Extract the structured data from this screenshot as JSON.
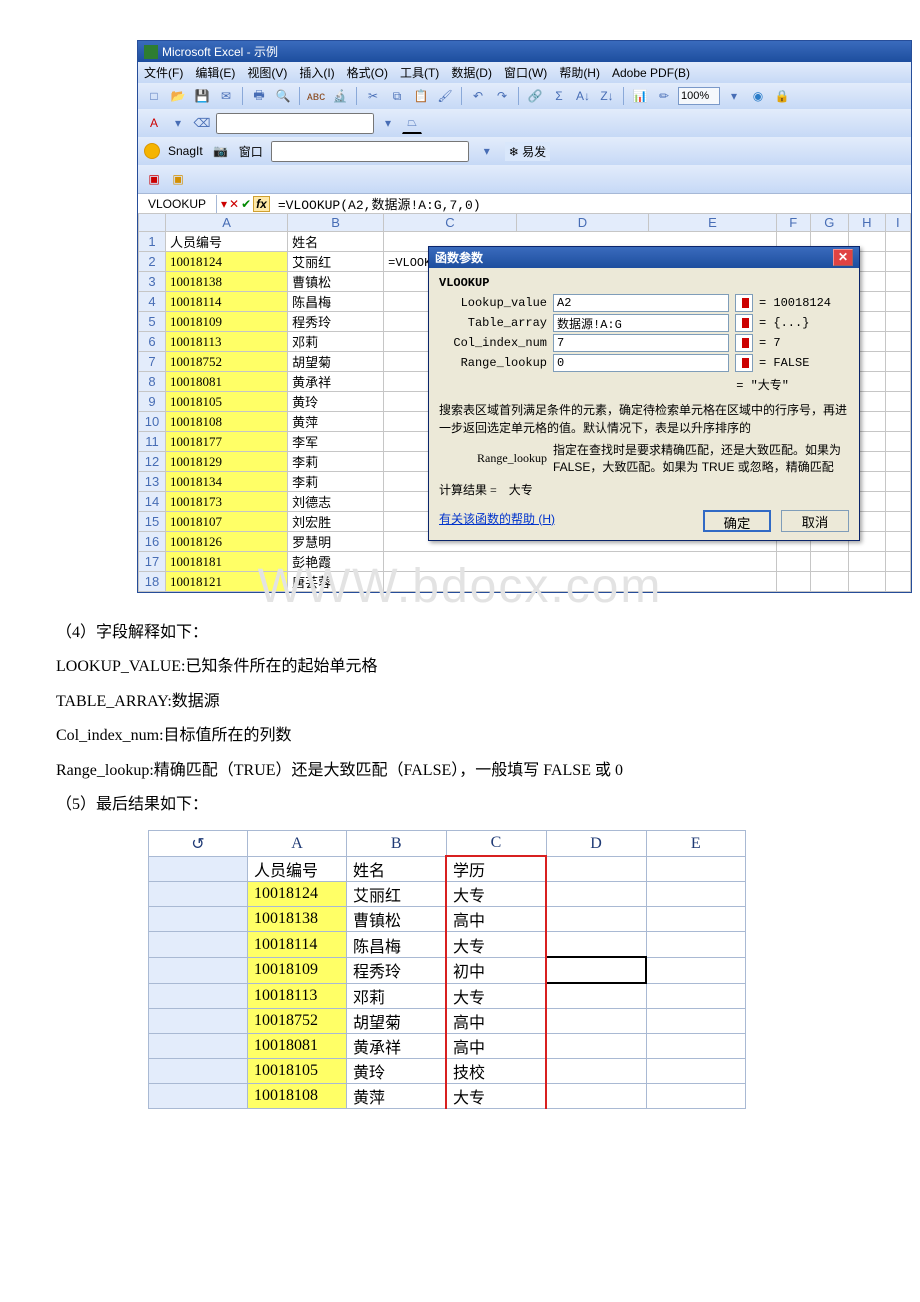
{
  "excel": {
    "title": "Microsoft Excel - 示例",
    "menus": [
      "文件(F)",
      "编辑(E)",
      "视图(V)",
      "插入(I)",
      "格式(O)",
      "工具(T)",
      "数据(D)",
      "窗口(W)",
      "帮助(H)",
      "Adobe PDF(B)"
    ],
    "zoom": "100%",
    "snagit": "SnagIt",
    "snagit_win": "窗口",
    "yifa": "易发",
    "namebox": "VLOOKUP",
    "formula": "=VLOOKUP(A2,数据源!A:G,7,0)",
    "cols": [
      "",
      "A",
      "B",
      "C",
      "D",
      "E",
      "F",
      "G",
      "H",
      "I"
    ],
    "rows": [
      {
        "n": "1",
        "a": "人员编号",
        "b": "姓名",
        "c": "",
        "edit": false,
        "hi": false
      },
      {
        "n": "2",
        "a": "10018124",
        "b": "艾丽红",
        "c": "=VLOOKUP(A2,数据源!A:G,7,0)",
        "edit": true,
        "hi": true
      },
      {
        "n": "3",
        "a": "10018138",
        "b": "曹镇松",
        "c": "",
        "edit": false,
        "hi": true
      },
      {
        "n": "4",
        "a": "10018114",
        "b": "陈昌梅",
        "c": "",
        "edit": false,
        "hi": true
      },
      {
        "n": "5",
        "a": "10018109",
        "b": "程秀玲",
        "c": "",
        "edit": false,
        "hi": true
      },
      {
        "n": "6",
        "a": "10018113",
        "b": "邓莉",
        "c": "",
        "edit": false,
        "hi": true
      },
      {
        "n": "7",
        "a": "10018752",
        "b": "胡望菊",
        "c": "",
        "edit": false,
        "hi": true
      },
      {
        "n": "8",
        "a": "10018081",
        "b": "黄承祥",
        "c": "",
        "edit": false,
        "hi": true
      },
      {
        "n": "9",
        "a": "10018105",
        "b": "黄玲",
        "c": "",
        "edit": false,
        "hi": true
      },
      {
        "n": "10",
        "a": "10018108",
        "b": "黄萍",
        "c": "",
        "edit": false,
        "hi": true
      },
      {
        "n": "11",
        "a": "10018177",
        "b": "李军",
        "c": "",
        "edit": false,
        "hi": true
      },
      {
        "n": "12",
        "a": "10018129",
        "b": "李莉",
        "c": "",
        "edit": false,
        "hi": true
      },
      {
        "n": "13",
        "a": "10018134",
        "b": "李莉",
        "c": "",
        "edit": false,
        "hi": true
      },
      {
        "n": "14",
        "a": "10018173",
        "b": "刘德志",
        "c": "",
        "edit": false,
        "hi": true
      },
      {
        "n": "15",
        "a": "10018107",
        "b": "刘宏胜",
        "c": "",
        "edit": false,
        "hi": true
      },
      {
        "n": "16",
        "a": "10018126",
        "b": "罗慧明",
        "c": "",
        "edit": false,
        "hi": true
      },
      {
        "n": "17",
        "a": "10018181",
        "b": "彭艳霞",
        "c": "",
        "edit": false,
        "hi": true
      },
      {
        "n": "18",
        "a": "10018121",
        "b": "唐芸蓉",
        "c": "",
        "edit": false,
        "hi": true
      }
    ]
  },
  "dialog": {
    "title": "函数参数",
    "fn": "VLOOKUP",
    "args": [
      {
        "label": "Lookup_value",
        "val": "A2",
        "res": "= 10018124"
      },
      {
        "label": "Table_array",
        "val": "数据源!A:G",
        "res": "= {...}"
      },
      {
        "label": "Col_index_num",
        "val": "7",
        "res": "= 7"
      },
      {
        "label": "Range_lookup",
        "val": "0",
        "res": "= FALSE"
      }
    ],
    "preview": "= \"大专\"",
    "desc": "搜索表区域首列满足条件的元素，确定待检索单元格在区域中的行序号，再进一步返回选定单元格的值。默认情况下，表是以升序排序的",
    "argdesc_label": "Range_lookup",
    "argdesc": "指定在查找时是要求精确匹配，还是大致匹配。如果为 FALSE，大致匹配。如果为 TRUE 或忽略，精确匹配",
    "calc_label": "计算结果 =",
    "calc_value": "大专",
    "help": "有关该函数的帮助 (H)",
    "ok": "确定",
    "cancel": "取消"
  },
  "doc": {
    "p4": "（4）字段解释如下：",
    "lookup": "LOOKUP_VALUE:已知条件所在的起始单元格",
    "tarray": "TABLE_ARRAY:数据源",
    "colidx": "Col_index_num:目标值所在的列数",
    "range": "Range_lookup:精确匹配（TRUE）还是大致匹配（FALSE），一般填写 FALSE 或 0",
    "p5": "（5）最后结果如下：",
    "watermark": "WWW.bdocx.com"
  },
  "result": {
    "cols": [
      "A",
      "B",
      "C",
      "D",
      "E"
    ],
    "rows": [
      {
        "a": "人员编号",
        "b": "姓名",
        "c": "学历",
        "hi": false,
        "sel": false
      },
      {
        "a": "10018124",
        "b": "艾丽红",
        "c": "大专",
        "hi": true,
        "sel": false
      },
      {
        "a": "10018138",
        "b": "曹镇松",
        "c": "高中",
        "hi": true,
        "sel": false
      },
      {
        "a": "10018114",
        "b": "陈昌梅",
        "c": "大专",
        "hi": true,
        "sel": false
      },
      {
        "a": "10018109",
        "b": "程秀玲",
        "c": "初中",
        "hi": true,
        "sel": true
      },
      {
        "a": "10018113",
        "b": "邓莉",
        "c": "大专",
        "hi": true,
        "sel": false
      },
      {
        "a": "10018752",
        "b": "胡望菊",
        "c": "高中",
        "hi": true,
        "sel": false
      },
      {
        "a": "10018081",
        "b": "黄承祥",
        "c": "高中",
        "hi": true,
        "sel": false
      },
      {
        "a": "10018105",
        "b": "黄玲",
        "c": "技校",
        "hi": true,
        "sel": false
      },
      {
        "a": "10018108",
        "b": "黄萍",
        "c": "大专",
        "hi": true,
        "sel": false
      }
    ]
  }
}
